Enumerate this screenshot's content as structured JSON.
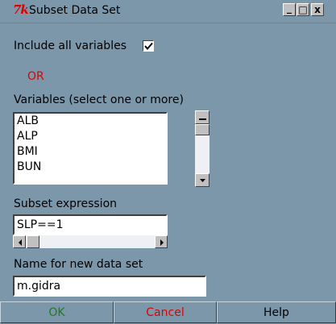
{
  "window": {
    "title": "Subset Data Set",
    "logo_text": "7k",
    "controls": {
      "minimize": "_",
      "maximize": "□",
      "close": "x"
    }
  },
  "include_all": {
    "label": "Include all variables",
    "checked": true
  },
  "or_label": "OR",
  "variables": {
    "label": "Variables (select one or more)",
    "items": [
      "ALB",
      "ALP",
      "BMI",
      "BUN"
    ]
  },
  "subset": {
    "label": "Subset expression",
    "value": "SLP==1"
  },
  "new_name": {
    "label": "Name for new data set",
    "value": "m.gidra"
  },
  "buttons": {
    "ok": "OK",
    "cancel": "Cancel",
    "help": "Help"
  },
  "colors": {
    "background": "#7c97a9",
    "ok_text": "#1e7a1e",
    "cancel_text": "#e00000",
    "or_text": "#e00000"
  }
}
